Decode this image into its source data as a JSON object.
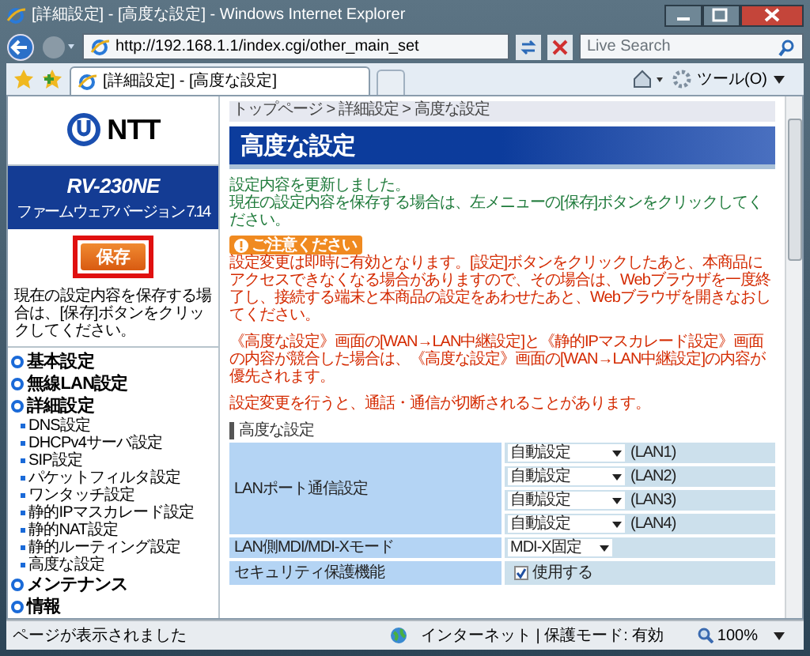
{
  "window": {
    "title": "[詳細設定] - [高度な設定] - Windows Internet Explorer"
  },
  "address_bar": {
    "url": "http://192.168.1.1/index.cgi/other_main_set",
    "search_placeholder": "Live Search"
  },
  "tabs": [
    {
      "label": "[詳細設定] - [高度な設定]",
      "selected": true
    }
  ],
  "toolbar": {
    "tools": "ツール(O)"
  },
  "sidebar": {
    "logo": "NTT",
    "model": "RV-230NE",
    "firmware": "ファームウェアバージョン 7.14",
    "save_button": {
      "label": "保存",
      "highlighted": true
    },
    "save_note": "現在の設定内容を保存する場合は、[保存]ボタンをクリックしてください。",
    "menu": [
      {
        "label": "基本設定"
      },
      {
        "label": "無線LAN設定"
      },
      {
        "label": "詳細設定",
        "children": [
          {
            "label": "DNS設定"
          },
          {
            "label": "DHCPv4サーバ設定"
          },
          {
            "label": "SIP設定"
          },
          {
            "label": "パケットフィルタ設定"
          },
          {
            "label": "ワンタッチ設定"
          },
          {
            "label": "静的IPマスカレード設定"
          },
          {
            "label": "静的NAT設定"
          },
          {
            "label": "静的ルーティング設定"
          },
          {
            "label": "高度な設定"
          }
        ]
      },
      {
        "label": "メンテナンス"
      },
      {
        "label": "情報"
      }
    ]
  },
  "main": {
    "breadcrumb": "トップページ > 詳細設定 > 高度な設定",
    "heading": "高度な設定",
    "info": [
      "設定内容を更新しました。",
      "現在の設定内容を保存する場合は、左メニューの[保存]ボタンをクリックしてください。"
    ],
    "notice_badge": "ご注意ください",
    "warnings": [
      "設定変更は即時に有効となります。[設定]ボタンをクリックしたあと、本商品にアクセスできなくなる場合がありますので、その場合は、Webブラウザを一度終了し、接続する端末と本商品の設定をあわせたあと、Webブラウザを開きなおしてください。",
      "《高度な設定》画面の[WAN→LAN中継設定]と《静的IPマスカレード設定》画面の内容が競合した場合は、《高度な設定》画面の[WAN→LAN中継設定]の内容が優先されます。",
      "設定変更を行うと、通話・通信が切断されることがあります。"
    ],
    "section_title": "高度な設定",
    "rows": [
      {
        "kind": "ports",
        "label": "LANポート通信設定",
        "ports": [
          {
            "value": "自動設定",
            "port": "(LAN1)"
          },
          {
            "value": "自動設定",
            "port": "(LAN2)"
          },
          {
            "value": "自動設定",
            "port": "(LAN3)"
          },
          {
            "value": "自動設定",
            "port": "(LAN4)"
          }
        ]
      },
      {
        "kind": "select",
        "label": "LAN側MDI/MDI-Xモード",
        "value": "MDI-X固定"
      },
      {
        "kind": "checkbox",
        "label": "セキュリティ保護機能",
        "option": "使用する",
        "checked": true
      }
    ]
  },
  "status_bar": {
    "message": "ページが表示されました",
    "zone": "インターネット | 保護モード: 有効",
    "zoom": "100%"
  }
}
